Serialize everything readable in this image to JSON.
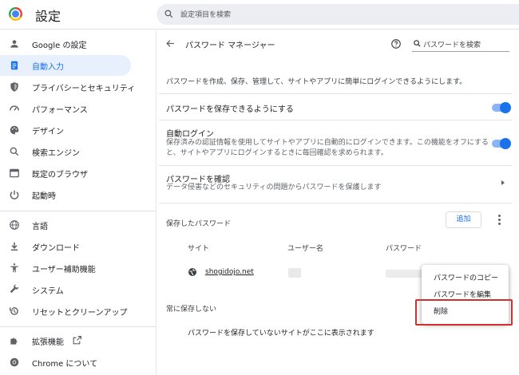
{
  "header": {
    "title": "設定",
    "search_placeholder": "設定項目を検索"
  },
  "sidebar": {
    "items": [
      {
        "label": "Google の設定",
        "icon": "person-icon"
      },
      {
        "label": "自動入力",
        "icon": "autofill-icon",
        "active": true
      },
      {
        "label": "プライバシーとセキュリティ",
        "icon": "shield-icon"
      },
      {
        "label": "パフォーマンス",
        "icon": "speedometer-icon"
      },
      {
        "label": "デザイン",
        "icon": "palette-icon"
      },
      {
        "label": "検索エンジン",
        "icon": "search-icon"
      },
      {
        "label": "既定のブラウザ",
        "icon": "browser-icon"
      },
      {
        "label": "起動時",
        "icon": "power-icon"
      },
      {
        "label": "言語",
        "icon": "globe-icon"
      },
      {
        "label": "ダウンロード",
        "icon": "download-icon"
      },
      {
        "label": "ユーザー補助機能",
        "icon": "accessibility-icon"
      },
      {
        "label": "システム",
        "icon": "wrench-icon"
      },
      {
        "label": "リセットとクリーンアップ",
        "icon": "reset-icon"
      },
      {
        "label": "拡張機能",
        "icon": "puzzle-icon"
      },
      {
        "label": "Chrome について",
        "icon": "chrome-icon"
      }
    ]
  },
  "main": {
    "title": "パスワード マネージャー",
    "search_placeholder": "パスワードを検索",
    "description": "パスワードを作成、保存、管理して、サイトやアプリに簡単にログインできるようにします。",
    "offer_save": {
      "label": "パスワードを保存できるようにする",
      "enabled": true
    },
    "auto_signin": {
      "label": "自動ログイン",
      "sub_line1": "保存済みの認証情報を使用してサイトやアプリに自動的にログインできます。この機能をオフにする",
      "sub_line2": "と、サイトやアプリにログインするときに毎回確認を求められます。",
      "enabled": true
    },
    "check": {
      "label": "パスワードを確認",
      "sub": "データ侵害などのセキュリティの問題からパスワードを保護します"
    },
    "saved_section": {
      "label": "保存したパスワード",
      "add_label": "追加",
      "columns": [
        "サイト",
        "ユーザー名",
        "パスワード"
      ],
      "rows": [
        {
          "site": "shogidojo.net"
        }
      ]
    },
    "never_section": {
      "label": "常に保存しない",
      "empty_text": "パスワードを保存していないサイトがここに表示されます"
    }
  },
  "context_menu": {
    "items": [
      "パスワードのコピー",
      "パスワードを編集",
      "削除"
    ],
    "highlighted": "削除"
  },
  "colors": {
    "accent": "#1a73e8",
    "active_bg": "#e8f0fe",
    "highlight_border": "#d32f2f"
  }
}
